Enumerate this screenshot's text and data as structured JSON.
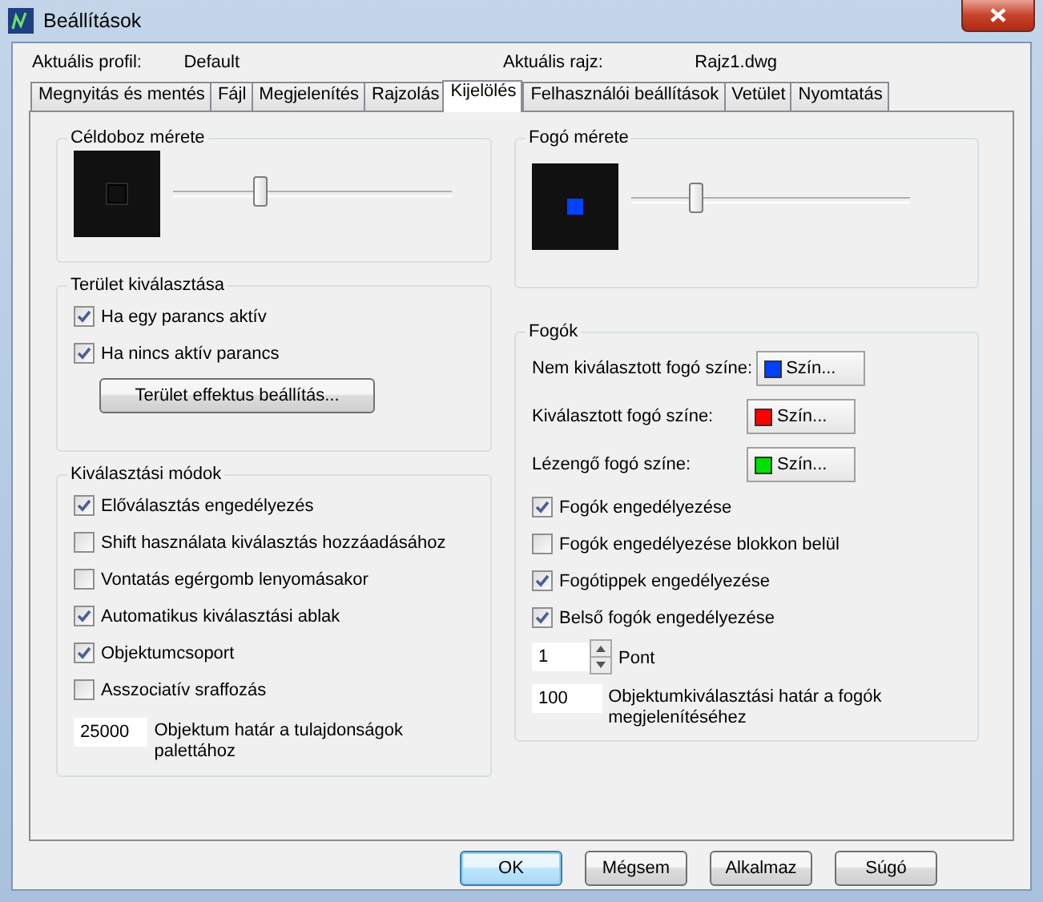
{
  "window": {
    "title": "Beállítások"
  },
  "profile": {
    "label": "Aktuális profil:",
    "value": "Default"
  },
  "drawing": {
    "label": "Aktuális rajz:",
    "value": "Rajz1.dwg"
  },
  "tabs": [
    {
      "label": "Megnyitás és mentés",
      "selected": false
    },
    {
      "label": "Fájl",
      "selected": false
    },
    {
      "label": "Megjelenítés",
      "selected": false
    },
    {
      "label": "Rajzolás",
      "selected": false
    },
    {
      "label": "Kijelölés",
      "selected": true
    },
    {
      "label": "Felhasználói beállítások",
      "selected": false
    },
    {
      "label": "Vetület",
      "selected": false
    },
    {
      "label": "Nyomtatás",
      "selected": false
    }
  ],
  "pickbox": {
    "title": "Céldoboz mérete",
    "level": 0.31
  },
  "area_selection": {
    "title": "Terület kiválasztása",
    "options": [
      {
        "label": "Ha egy parancs aktív",
        "checked": true
      },
      {
        "label": "Ha nincs aktív parancs",
        "checked": true
      }
    ],
    "button": "Terület effektus beállítás..."
  },
  "selection_modes": {
    "title": "Kiválasztási módok",
    "options": [
      {
        "label": "Előválasztás engedélyezés",
        "checked": true
      },
      {
        "label": "Shift használata kiválasztás hozzáadásához",
        "checked": false
      },
      {
        "label": "Vontatás egérgomb lenyomásakor",
        "checked": false
      },
      {
        "label": "Automatikus kiválasztási ablak",
        "checked": true
      },
      {
        "label": "Objektumcsoport",
        "checked": true
      },
      {
        "label": "Asszociatív sraffozás",
        "checked": false
      }
    ],
    "limit": {
      "value": "25000",
      "label": "Objektum határ a tulajdonságok palettához"
    }
  },
  "grip_size": {
    "title": "Fogó mérete",
    "level": 0.23
  },
  "grips": {
    "title": "Fogók",
    "colors": [
      {
        "label": "Nem kiválasztott fogó színe:",
        "button": "Szín...",
        "color": "#0040ff"
      },
      {
        "label": "Kiválasztott fogó színe:",
        "button": "Szín...",
        "color": "#ff0000"
      },
      {
        "label": "Lézengő fogó színe:",
        "button": "Szín...",
        "color": "#00e000"
      }
    ],
    "options": [
      {
        "label": "Fogók engedélyezése",
        "checked": true
      },
      {
        "label": "Fogók engedélyezése blokkon belül",
        "checked": false
      },
      {
        "label": "Fogótippek engedélyezése",
        "checked": true
      },
      {
        "label": "Belső fogók engedélyezése",
        "checked": true
      }
    ],
    "spinner": {
      "value": "1",
      "label": "Pont"
    },
    "limit": {
      "value": "100",
      "label": "Objektumkiválasztási határ a fogók megjelenítéséhez"
    }
  },
  "buttons": [
    {
      "label": "OK",
      "kind": "default"
    },
    {
      "label": "Mégsem",
      "kind": "normal"
    },
    {
      "label": "Alkalmaz",
      "kind": "normal"
    },
    {
      "label": "Súgó",
      "kind": "normal"
    }
  ]
}
